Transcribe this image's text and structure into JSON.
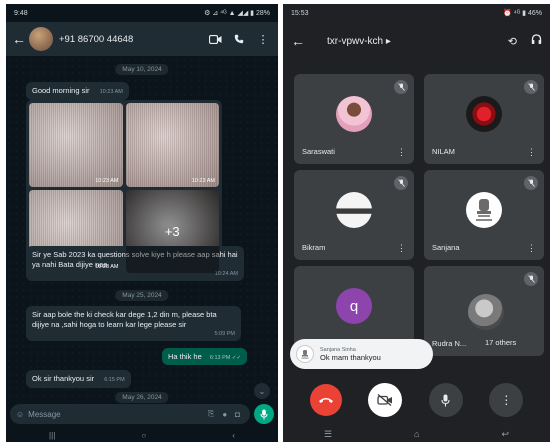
{
  "whatsapp": {
    "status_bar": {
      "time": "9:48",
      "icons": "⚙ ⊿ ⁴ᴳ ▲ ◢◢ ▮ 28%"
    },
    "header": {
      "contact": "+91 86700 44648"
    },
    "chat": {
      "date_1": "May 10, 2024",
      "msg_good_morning": "Good morning sir",
      "msg_good_morning_time": "10:23 AM",
      "photos": {
        "time_1": "10:23 AM",
        "time_2": "10:23 AM",
        "time_3": "10:23 AM",
        "more": "+3"
      },
      "msg_questions": "Sir ye Sab 2023 ka questions solve kiye h please aap sahi hai ya nahi Bata dijiye naa",
      "msg_questions_time": "10:24 AM",
      "date_2": "May 25, 2024",
      "msg_check": "Sir aap bole the ki check kar dege 1,2 din m, please bta dijiye na ,sahi hoga to learn kar lege please sir",
      "msg_check_time": "5:09 PM",
      "msg_out": "Ha thik he",
      "msg_out_time": "6:13 PM ✓✓",
      "msg_thanks": "Ok sir thankyou sir",
      "msg_thanks_time": "6:15 PM",
      "date_3": "May 26, 2024"
    },
    "composer": {
      "placeholder": "Message"
    }
  },
  "meet": {
    "status_bar": {
      "time": "15:53",
      "icons": "⏰ ⁴ᴳ ▮ 46%"
    },
    "header": {
      "meeting_code": "txr-vpwv-kch ▸"
    },
    "participants": [
      {
        "name": "Saraswati"
      },
      {
        "name": "NILAM"
      },
      {
        "name": "Bikram"
      },
      {
        "name": "Sanjana"
      },
      {
        "name": "q",
        "initial": "q"
      },
      {
        "name": "Rudra N...",
        "others": "17 others"
      }
    ],
    "toast": {
      "sender": "Sanjana Sinha",
      "message": "Ok mam thankyou"
    }
  }
}
